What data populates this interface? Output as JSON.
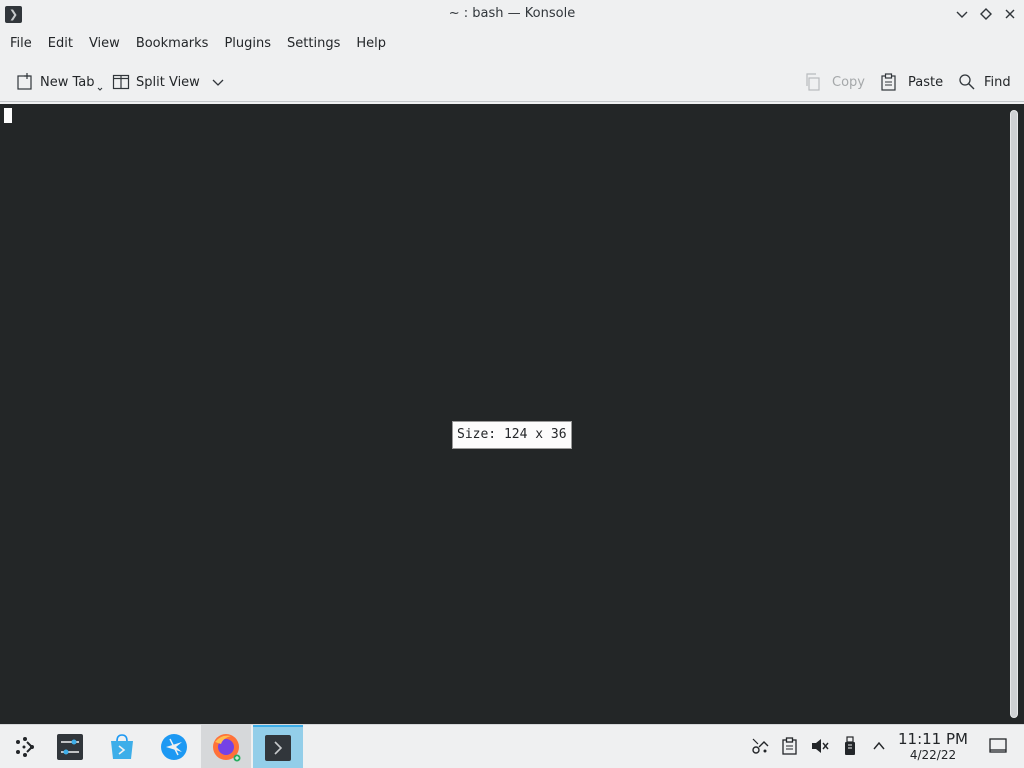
{
  "window": {
    "title": "~ : bash — Konsole"
  },
  "menu": [
    "File",
    "Edit",
    "View",
    "Bookmarks",
    "Plugins",
    "Settings",
    "Help"
  ],
  "toolbar": {
    "new_tab": "New Tab",
    "split_view": "Split View",
    "copy": "Copy",
    "paste": "Paste",
    "find": "Find"
  },
  "terminal": {
    "size_tooltip": "Size: 124 x 36"
  },
  "taskbar": {
    "apps": [
      "application-launcher-icon",
      "system-settings-icon",
      "discover-store-icon",
      "kde-connect-icon",
      "firefox-icon",
      "konsole-icon"
    ],
    "tray": [
      "kde-connect-tray-icon",
      "clipboard-icon",
      "volume-muted-icon",
      "usb-device-icon",
      "expand-tray-icon"
    ],
    "clock_time": "11:11 PM",
    "clock_date": "4/22/22"
  },
  "colors": {
    "terminal_bg": "#232627",
    "accent": "#3daee9",
    "chrome_bg": "#eff0f1"
  }
}
